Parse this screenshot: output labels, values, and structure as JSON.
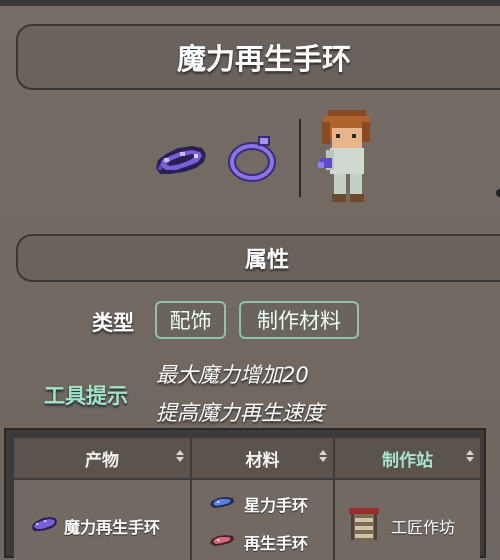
{
  "item": {
    "title": "魔力再生手环",
    "icons": [
      "mana-regeneration-band-icon",
      "band-outline-icon"
    ],
    "character": "player-character-icon"
  },
  "properties": {
    "section_title": "属性",
    "type_label": "类型",
    "type_tags": [
      "配饰",
      "制作材料"
    ],
    "tooltip_label": "工具提示",
    "tooltip_lines": [
      "最大魔力增加20",
      "提高魔力再生速度"
    ]
  },
  "recipe_table": {
    "headers": [
      "产物",
      "材料",
      "制作站"
    ],
    "rows": [
      {
        "product": "魔力再生手环",
        "materials": [
          "星力手环",
          "再生手环"
        ],
        "station": "工匠作坊"
      }
    ]
  },
  "colors": {
    "accent": "#9fe5c6",
    "background": "#6f6761",
    "header": "#5a534e"
  }
}
